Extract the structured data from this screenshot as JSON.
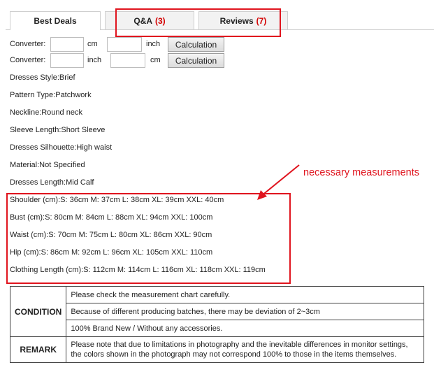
{
  "tabs": [
    {
      "label": "Best Deals",
      "count": ""
    },
    {
      "label": "Q&A",
      "count": "(3)"
    },
    {
      "label": "Reviews",
      "count": "(7)"
    }
  ],
  "converter": {
    "label": "Converter:",
    "row1": {
      "from_unit": "cm",
      "to_unit": "inch",
      "value_from": "",
      "value_to": "",
      "button": "Calculation"
    },
    "row2": {
      "from_unit": "inch",
      "to_unit": "cm",
      "value_from": "",
      "value_to": "",
      "button": "Calculation"
    }
  },
  "attributes": [
    "Dresses Style:Brief",
    "Pattern Type:Patchwork",
    "Neckline:Round neck",
    "Sleeve Length:Short Sleeve",
    "Dresses Silhouette:High waist",
    "Material:Not Specified",
    "Dresses Length:Mid Calf"
  ],
  "measurements": [
    "Shoulder (cm):S: 36cm M: 37cm L: 38cm XL: 39cm XXL: 40cm",
    "Bust (cm):S: 80cm M: 84cm L: 88cm XL: 94cm XXL: 100cm",
    "Waist (cm):S: 70cm M: 75cm L: 80cm XL: 86cm XXL: 90cm",
    "Hip (cm):S: 86cm M: 92cm L: 96cm XL: 105cm XXL: 110cm",
    "Clothing Length (cm):S: 112cm M: 114cm L: 116cm XL: 118cm XXL: 119cm"
  ],
  "annotation": "necessary measurements",
  "condition": {
    "label": "CONDITION",
    "lines": [
      "Please check the measurement chart carefully.",
      "Because of different producing batches, there may be deviation of 2~3cm",
      "100% Brand New / Without any accessories."
    ]
  },
  "remark": {
    "label": "REMARK",
    "text": "Please note that due to limitations in photography and the inevitable differences in monitor settings, the colors shown in the photograph may not correspond 100% to those in the items themselves."
  },
  "colors": {
    "highlight": "#e0141e",
    "count": "#d40000"
  }
}
